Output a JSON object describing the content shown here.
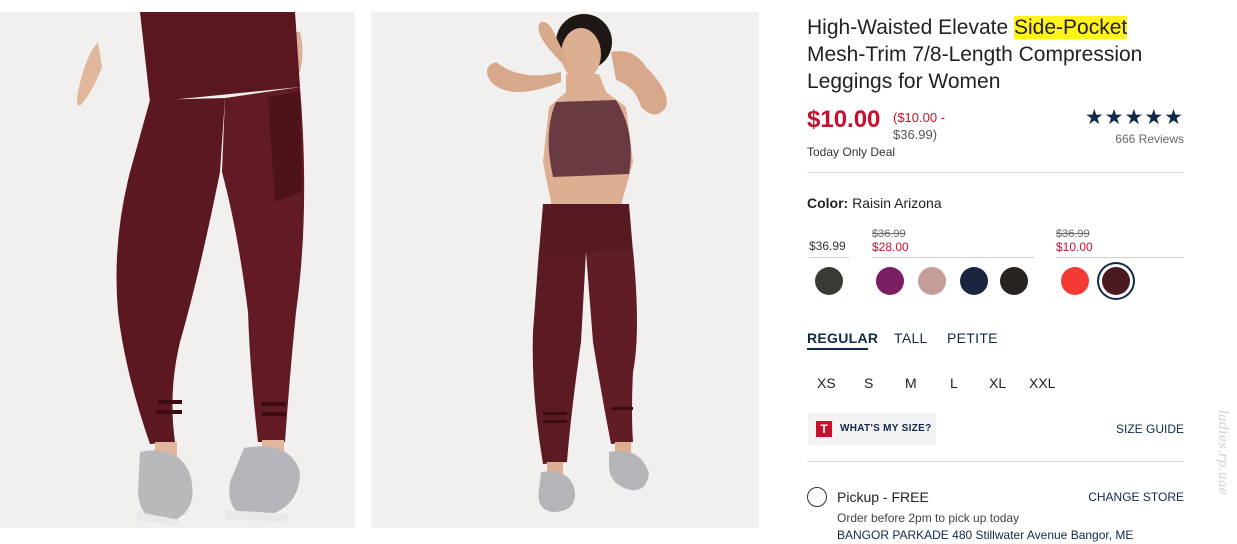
{
  "product": {
    "title_before": "High-Waisted Elevate ",
    "title_highlight": "Side-Pocket",
    "title_after": " Mesh-Trim 7/8-Length Compression Leggings for Women",
    "price": "$10.00",
    "price_range_line1": "($10.00 -",
    "price_range_line2": "$36.99)",
    "deal_label": "Today Only Deal",
    "rating_stars": "★★★★★",
    "rating_value": 4.5,
    "reviews": "666 Reviews"
  },
  "color": {
    "label": "Color:",
    "selected": "Raisin Arizona",
    "groups": [
      {
        "price": "$36.99"
      },
      {
        "old_price": "$36.99",
        "price": "$28.00"
      },
      {
        "old_price": "$36.99",
        "price": "$10.00"
      }
    ],
    "swatches": [
      {
        "hex": "#3b3b36"
      },
      {
        "hex": "#7a1d62"
      },
      {
        "hex": "#c49c98"
      },
      {
        "hex": "#1a2640"
      },
      {
        "hex": "#262321"
      },
      {
        "hex": "#f53a35"
      },
      {
        "hex": "#4a1a22",
        "selected": true
      }
    ]
  },
  "fit_tabs": [
    "REGULAR",
    "TALL",
    "PETITE"
  ],
  "sizes": [
    "XS",
    "S",
    "M",
    "L",
    "XL",
    "XXL"
  ],
  "size_help": {
    "icon_letter": "T",
    "label": "WHAT'S MY SIZE?",
    "guide": "SIZE GUIDE"
  },
  "pickup": {
    "label": "Pickup - FREE",
    "change_store": "CHANGE STORE",
    "note": "Order before 2pm to pick up today",
    "store_name": "BANGOR PARKADE",
    "store_address": "480 Stillwater Avenue",
    "store_city": "Bangor, ME"
  },
  "watermark": "ladies.rp.uae",
  "colors": {
    "sale_red": "#c8102e",
    "navy": "#12294a",
    "highlight": "#fff21d"
  }
}
